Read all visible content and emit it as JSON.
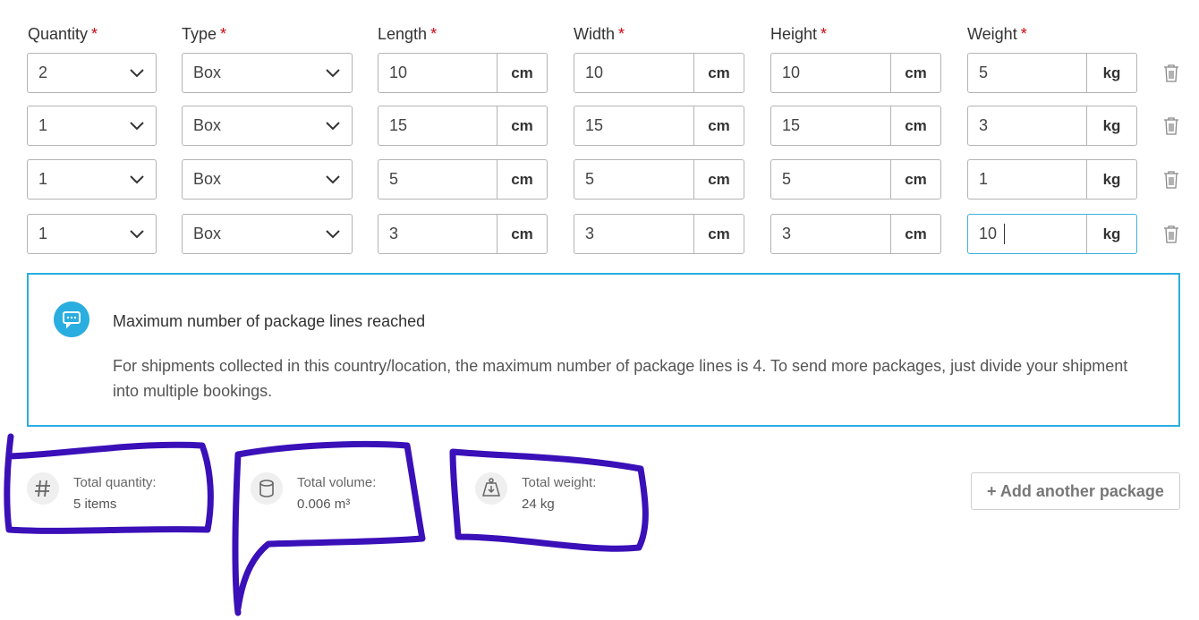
{
  "columns": {
    "quantity": "Quantity",
    "type": "Type",
    "length": "Length",
    "width": "Width",
    "height": "Height",
    "weight": "Weight",
    "required_mark": "*"
  },
  "rows": [
    {
      "quantity": "2",
      "type": "Box",
      "length": "10",
      "width": "10",
      "height": "10",
      "weight": "5"
    },
    {
      "quantity": "1",
      "type": "Box",
      "length": "15",
      "width": "15",
      "height": "15",
      "weight": "3"
    },
    {
      "quantity": "1",
      "type": "Box",
      "length": "5",
      "width": "5",
      "height": "5",
      "weight": "1"
    },
    {
      "quantity": "1",
      "type": "Box",
      "length": "3",
      "width": "3",
      "height": "3",
      "weight": "10"
    }
  ],
  "units": {
    "dimension": "cm",
    "weight": "kg"
  },
  "notice": {
    "title": "Maximum number of package lines reached",
    "body": "For shipments collected in this country/location, the maximum number of package lines is 4. To send more packages, just divide your shipment into multiple bookings.",
    "icon": "chat-bubble-icon"
  },
  "totals": {
    "quantity_label": "Total quantity:",
    "quantity_value": "5 items",
    "volume_label": "Total volume:",
    "volume_value": "0.006 m³",
    "weight_label": "Total weight:",
    "weight_value": "24 kg"
  },
  "add_button": "+ Add another package",
  "colors": {
    "accent": "#2aaedf",
    "required": "#d40511",
    "annotation": "#3a10b8",
    "border": "#b4b4b4"
  }
}
